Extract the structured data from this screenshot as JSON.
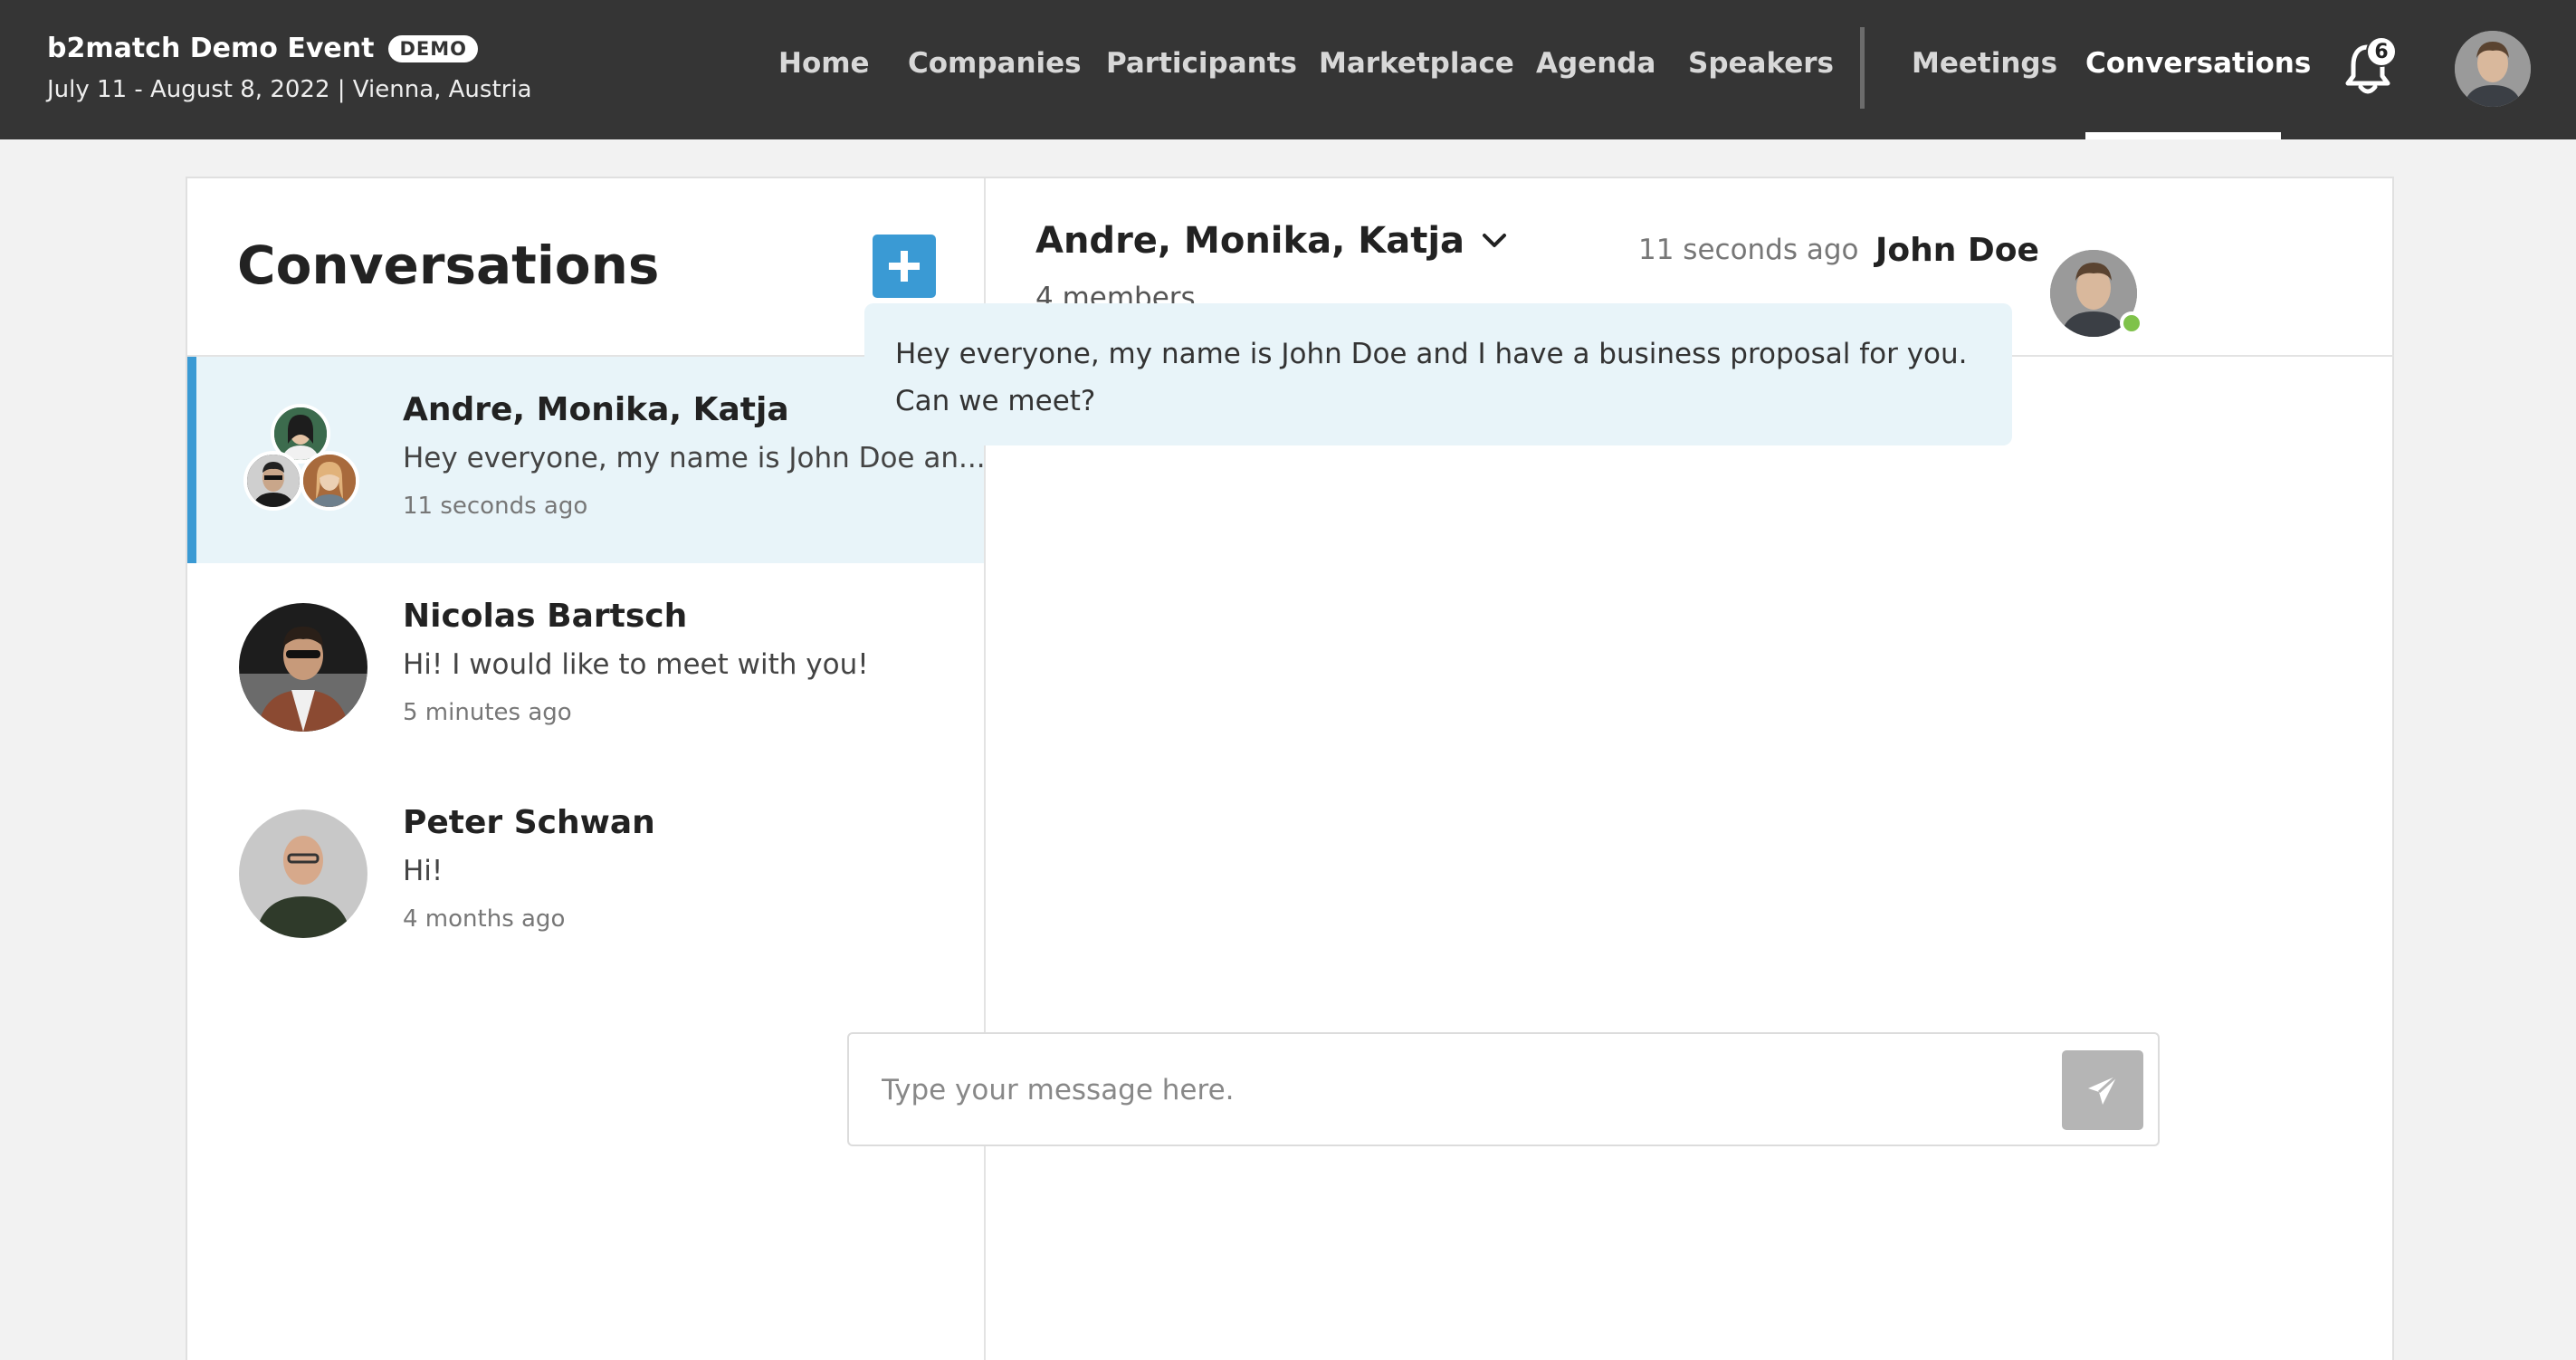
{
  "event": {
    "title": "b2match Demo Event",
    "badge": "DEMO",
    "subtitle": "July 11 - August 8, 2022 | Vienna, Austria"
  },
  "nav": {
    "items": [
      {
        "label": "Home"
      },
      {
        "label": "Companies"
      },
      {
        "label": "Participants"
      },
      {
        "label": "Marketplace"
      },
      {
        "label": "Agenda"
      },
      {
        "label": "Speakers"
      },
      {
        "label": "Meetings"
      },
      {
        "label": "Conversations",
        "active": true
      }
    ],
    "notifications_count": "6"
  },
  "sidebar": {
    "title": "Conversations",
    "conversations": [
      {
        "name": "Andre, Monika, Katja",
        "preview": "Hey everyone, my name is John Doe an...",
        "time": "11 seconds ago",
        "selected": true
      },
      {
        "name": "Nicolas Bartsch",
        "preview": "Hi! I would like to meet with you!",
        "time": "5 minutes ago"
      },
      {
        "name": "Peter Schwan",
        "preview": "Hi!",
        "time": "4 months ago"
      }
    ]
  },
  "chat": {
    "title": "Andre, Monika, Katja",
    "members": "4 members",
    "messages": [
      {
        "author": "John Doe",
        "time": "11 seconds ago",
        "text": "Hey everyone, my name is John Doe and I have a business proposal for you. Can we meet?"
      }
    ],
    "composer_placeholder": "Type your message here."
  },
  "colors": {
    "topbar": "#353535",
    "accent": "#3a9ad4",
    "selected_bg": "#e8f4f9",
    "online": "#7fc24a"
  }
}
